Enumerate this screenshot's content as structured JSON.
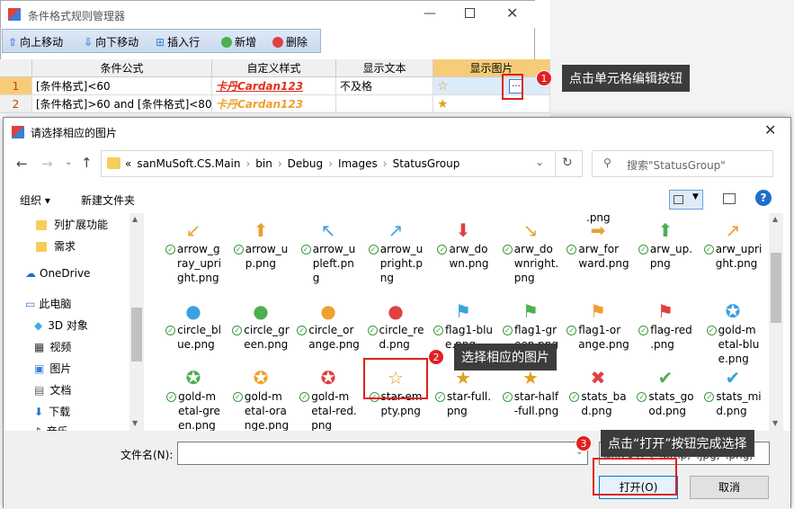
{
  "bg": {
    "title": "条件格式规则管理器",
    "toolbar": [
      "向上移动",
      "向下移动",
      "插入行",
      "新增",
      "删除"
    ],
    "columns": [
      "条件公式",
      "自定义样式",
      "显示文本",
      "显示图片"
    ],
    "rows": [
      {
        "num": "1",
        "formula": "[条件格式]<60",
        "style": "卡丹Cardan123",
        "text": "不及格"
      },
      {
        "num": "2",
        "formula": "[条件格式]>60 and [条件格式]<80",
        "style": "卡丹Cardan123",
        "text": ""
      }
    ],
    "edit_btn": "..."
  },
  "dialog": {
    "title": "请选择相应的图片",
    "path": [
      "«",
      "sanMuSoft.CS.Main",
      "bin",
      "Debug",
      "Images",
      "StatusGroup"
    ],
    "search_placeholder": "搜索\"StatusGroup\"",
    "organize": "组织 ▾",
    "new_folder": "新建文件夹",
    "help": "?",
    "nav": [
      "列扩展功能",
      "需求",
      "OneDrive",
      "此电脑",
      "3D 对象",
      "视频",
      "图片",
      "文档",
      "下载",
      "音乐"
    ],
    "top_partial": ".png",
    "files": [
      [
        "arrow_g\nray_upri\nght.png",
        "arrow_u\np.png",
        "arrow_u\npleft.pn\ng",
        "arrow_u\npright.p\nng",
        "arw_do\nwn.png",
        "arw_do\nwnright.\npng",
        "arw_for\nward.png",
        "arw_up.\npng",
        "arw_upri\nght.png"
      ],
      [
        "circle_bl\nue.png",
        "circle_gr\neen.png",
        "circle_or\nange.png",
        "circle_re\nd.png",
        "flag1-blu\ne.png",
        "flag1-gr\neen.png",
        "flag1-or\nange.png",
        "flag-red\n.png",
        "gold-m\netal-blu\ne.png"
      ],
      [
        "gold-m\netal-gre\nen.png",
        "gold-m\netal-ora\nnge.png",
        "gold-m\netal-red.\npng",
        "star-em\npty.png",
        "star-full.\npng",
        "star-half\n-full.png",
        "stats_ba\nd.png",
        "stats_go\nod.png",
        "stats_mi\nd.png"
      ]
    ],
    "filename_label": "文件名(N):",
    "filetype": "图形文件 (*.bmp;*.jpg;*.png;",
    "open": "打开(O)",
    "cancel": "取消"
  },
  "callouts": {
    "c1": "点击单元格编辑按钮",
    "c2": "选择相应的图片",
    "c3": "点击“打开”按钮完成选择",
    "n1": "1",
    "n2": "2",
    "n3": "3"
  },
  "colors": {
    "accent": "#e02020",
    "orange": "#f0a030",
    "blue": "#3ba0e0",
    "green": "#4caf50",
    "red": "#e04040"
  }
}
